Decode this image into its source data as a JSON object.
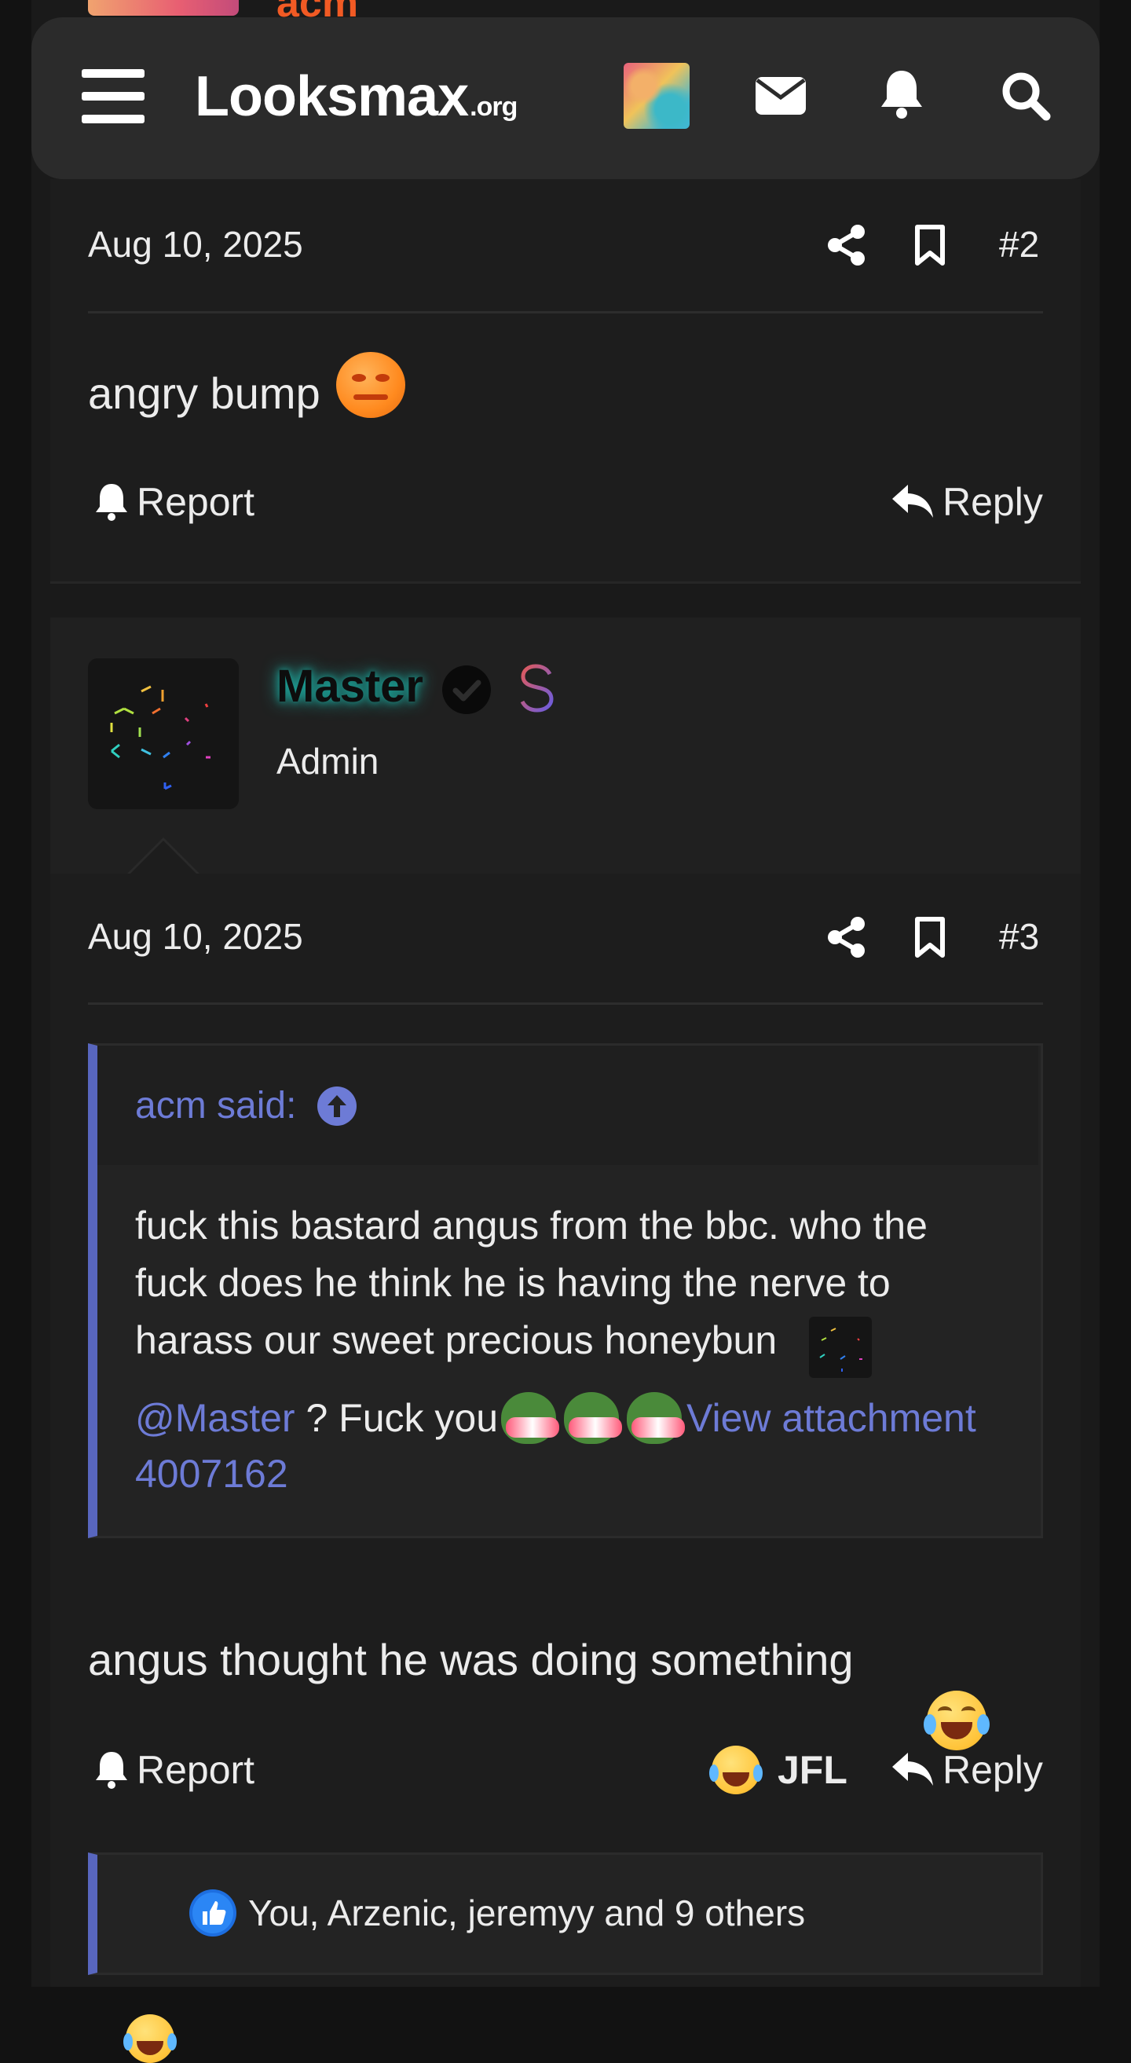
{
  "site": {
    "name": "Looksmax",
    "tld": ".org"
  },
  "icons": {
    "menu": "hamburger-menu-icon",
    "messages": "envelope-icon",
    "alerts": "bell-icon",
    "search": "search-icon",
    "share": "share-icon",
    "bookmark": "bookmark-icon",
    "reply": "reply-arrow-icon",
    "report": "bell-icon",
    "verified": "verified-check-icon",
    "upgrade": "dollar-icon",
    "quote_jump": "arrow-up-circle-icon"
  },
  "previous_author": {
    "name": "acm"
  },
  "post2": {
    "date": "Aug 10, 2025",
    "number": "#2",
    "message": "angry bump",
    "report_label": "Report",
    "reply_label": "Reply"
  },
  "post3": {
    "author": {
      "name": "Master",
      "title": "Admin"
    },
    "date": "Aug 10, 2025",
    "number": "#3",
    "quote": {
      "author_label": "acm said:",
      "line1": "fuck this bastard angus from the bbc. who the",
      "line2": "fuck does he think he is having the nerve to",
      "line3": "harass our sweet precious honeybun",
      "mention": "@Master",
      "after_mention": " ? Fuck you",
      "attachment_line1": "View attachment",
      "attachment_line2": "4007162"
    },
    "message": "angus thought he was doing something",
    "report_label": "Report",
    "reaction_label": "JFL",
    "reply_label": "Reply",
    "reactions_summary": "You, Arzenic, jeremyy and 9 others"
  },
  "colors": {
    "background": "#1a1a1a",
    "header": "#2b2b2b",
    "accent_link": "#6d7bd6",
    "quote_border": "#5866be",
    "username_glow": "#1fb3a7",
    "previous_author": "#f15a24"
  }
}
